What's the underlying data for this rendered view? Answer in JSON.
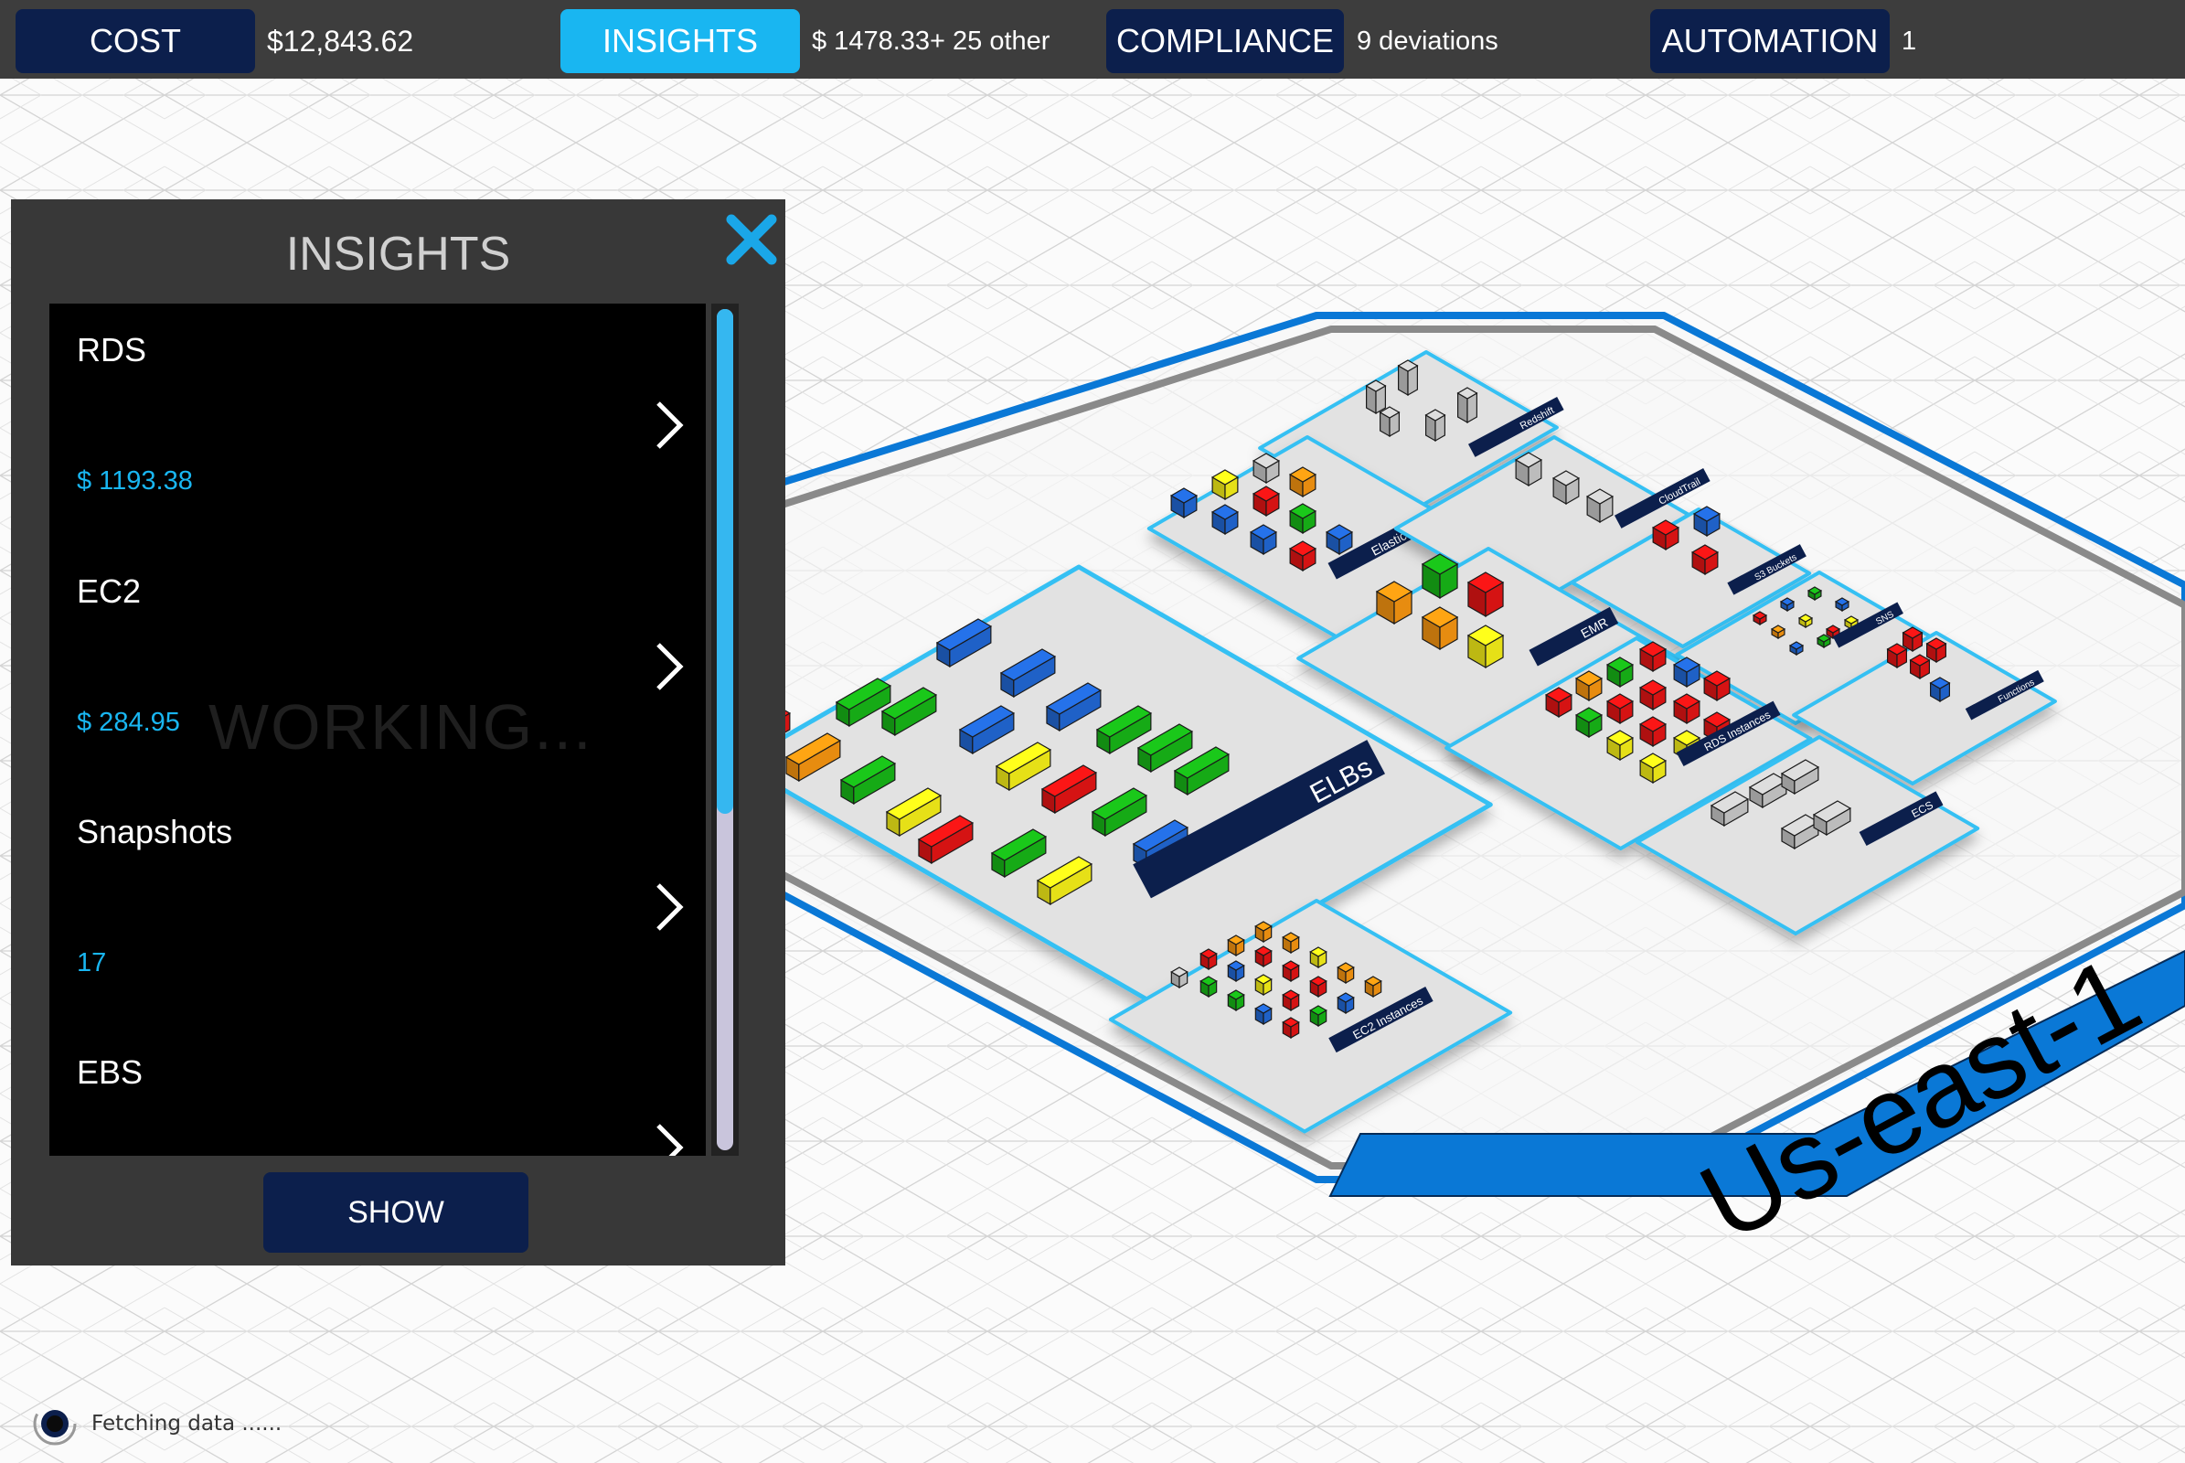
{
  "topbar": {
    "cost": {
      "label": "COST",
      "value": "$12,843.62"
    },
    "insights": {
      "label": "INSIGHTS",
      "value": "$ 1478.33+ 25 other"
    },
    "compliance": {
      "label": "COMPLIANCE",
      "value": "9 deviations"
    },
    "automation": {
      "label": "AUTOMATION",
      "value": "1"
    }
  },
  "panel": {
    "title": "INSIGHTS",
    "items": [
      {
        "name": "RDS",
        "value": "$ 1193.38"
      },
      {
        "name": "EC2",
        "value": "$ 284.95"
      },
      {
        "name": "Snapshots",
        "value": "17"
      },
      {
        "name": "EBS",
        "value": ""
      }
    ],
    "show_label": "SHOW",
    "scroll_position": 0.6
  },
  "overlay": {
    "working_text": "WORKING..."
  },
  "map": {
    "region_label": "Us-east-1",
    "groups": [
      {
        "label": "ELBs"
      },
      {
        "label": "Redshift"
      },
      {
        "label": "Elasticache"
      },
      {
        "label": "CloudTrail"
      },
      {
        "label": "S3 Buckets"
      },
      {
        "label": "EMR"
      },
      {
        "label": "SNS"
      },
      {
        "label": "Functions"
      },
      {
        "label": "RDS Instances"
      },
      {
        "label": "ECS"
      },
      {
        "label": "EC2 Instances"
      }
    ]
  },
  "status": {
    "text": "Fetching data ......"
  },
  "colors": {
    "navy": "#0c1f4c",
    "accent": "#19b6f1",
    "region_blue": "#0a78d6",
    "block_blue": "#2166d1",
    "block_green": "#17b317",
    "block_red": "#e01414",
    "block_orange": "#f39311",
    "block_yellow": "#f2ec18",
    "block_gray": "#c6c6c6"
  }
}
